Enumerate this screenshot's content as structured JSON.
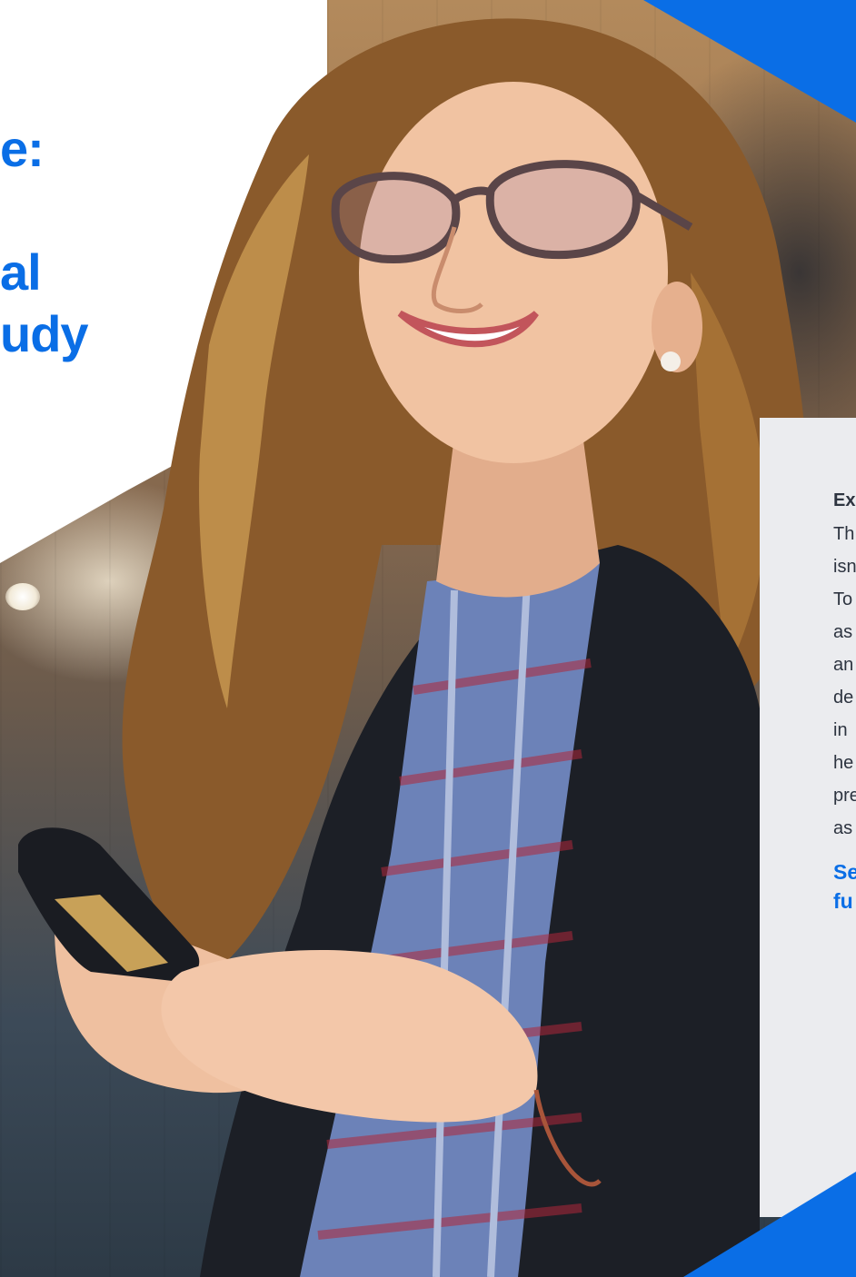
{
  "hero": {
    "headline_line1": "e:",
    "headline_line2": "al",
    "headline_line3": "udy"
  },
  "panel": {
    "heading": "Ex",
    "body_lines": [
      "Th",
      "isn",
      "To",
      "as",
      "an",
      "de",
      "in",
      "he",
      "pre",
      "as"
    ],
    "link_lines": [
      "Se",
      "fu"
    ]
  },
  "colors": {
    "brand_blue": "#0a6ee6",
    "panel_grey": "#ebecef",
    "body_text": "#2d3440"
  },
  "image": {
    "subject": "woman-with-glasses-holding-smartphone"
  }
}
